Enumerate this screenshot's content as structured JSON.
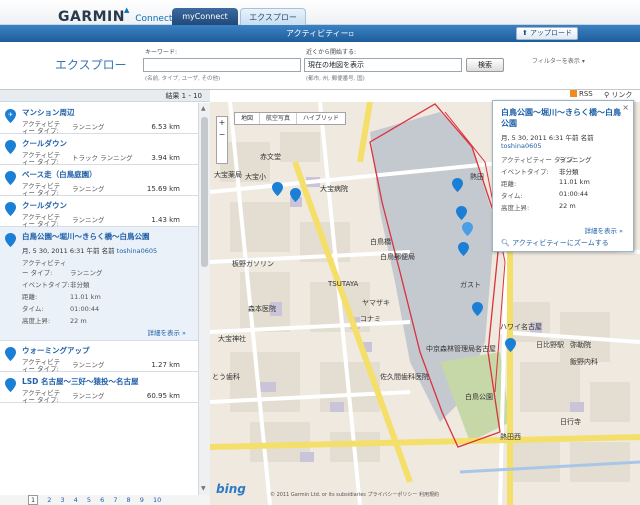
{
  "header": {
    "logo_text": "GARMIN",
    "logo_connect": "Connect",
    "tabs": [
      {
        "label": "myConnect"
      },
      {
        "label": "エクスプロー"
      }
    ],
    "activity_label": "アクティビティー▫",
    "upload_button": "⬆ アップロード"
  },
  "search": {
    "page_title": "エクスプロー",
    "keyword_label": "キーワード:",
    "keyword_value": "",
    "keyword_hint": "(名前, タイプ, ユーザ, その他)",
    "near_label": "近くから開始する:",
    "near_value": "現在の地図を表示",
    "near_hint": "(都市, 州, 郵便番号, 国)",
    "search_button": "検索",
    "filter_label": "フィルターを表示"
  },
  "results": {
    "count_label": "結果 1 - 10",
    "rss_label": "RSS",
    "link_label": "リンク",
    "items": [
      {
        "title": "マンション周辺",
        "type_key": "アクティビティー タイプ:",
        "type": "ランニング",
        "distance": "6.53 km"
      },
      {
        "title": "クールダウン",
        "type_key": "アクティビティー タイプ:",
        "type": "トラック ランニング",
        "distance": "3.94 km"
      },
      {
        "title": "ベース走（白鳥庭園）",
        "type_key": "アクティビティー タイプ:",
        "type": "ランニング",
        "distance": "15.69 km"
      },
      {
        "title": "クールダウン",
        "type_key": "アクティビティー タイプ:",
        "type": "ランニング",
        "distance": "1.43 km"
      }
    ],
    "selected": {
      "title": "白鳥公園～堀川～きらく橋～白鳥公園",
      "date": "月, 5 30, 2011 6:31 午前 名前",
      "user": "toshina0605",
      "type_key": "アクティビティー タイプ:",
      "type": "ランニング",
      "event_key": "イベントタイプ:",
      "event": "非分類",
      "dist_key": "距離:",
      "dist": "11.01 km",
      "time_key": "タイム:",
      "time": "01:00:44",
      "gain_key": "高度上昇:",
      "gain": "22 m",
      "show_details": "詳細を表示 »"
    },
    "items_after": [
      {
        "title": "ウォーミングアップ",
        "type_key": "アクティビティー タイプ:",
        "type": "ランニング",
        "distance": "1.27 km"
      },
      {
        "title": "LSD 名古屋～三好～猿投～名古屋",
        "type_key": "アクティビティー タイプ:",
        "type": "ランニング",
        "distance": "60.95 km"
      }
    ]
  },
  "pager": {
    "current": "1",
    "pages": [
      "2",
      "3",
      "4",
      "5",
      "6",
      "7",
      "8",
      "9",
      "10"
    ]
  },
  "map": {
    "type_buttons": [
      "地図",
      "航空写真",
      "ハイブリッド"
    ],
    "labels": [
      {
        "t": "赤文堂"
      },
      {
        "t": "大宝病院"
      },
      {
        "t": "大宝小"
      },
      {
        "t": "白鳥橋"
      },
      {
        "t": "板野ガソリン"
      },
      {
        "t": "TSUTAYA"
      },
      {
        "t": "森本医院"
      },
      {
        "t": "大宝神社"
      },
      {
        "t": "中京森林管理局名古屋"
      },
      {
        "t": "熱田"
      },
      {
        "t": "日比野駅"
      },
      {
        "t": "佐久間歯科医院"
      },
      {
        "t": "飯野内科"
      },
      {
        "t": "日行寺"
      },
      {
        "t": "白鳥公園"
      },
      {
        "t": "白鳥郵便局"
      },
      {
        "t": "ヤマザキ"
      },
      {
        "t": "コナミ"
      },
      {
        "t": "ガスト"
      },
      {
        "t": "熱田西"
      },
      {
        "t": "ハワイ名古屋"
      },
      {
        "t": "弥勒院"
      },
      {
        "t": "とう歯科"
      },
      {
        "t": "大宝薬局"
      }
    ],
    "bing": "bing",
    "copyright": "© 2011 Garmin Ltd. or its subsidiaries プライバシーポリシー 利用規約"
  },
  "bubble": {
    "title": "白鳥公園～堀川～きらく橋～白鳥公園",
    "date": "月, 5 30, 2011 6:31 午前 名前",
    "user": "toshina0605",
    "type_key": "アクティビティー タイプ:",
    "type": "ランニング",
    "event_key": "イベントタイプ:",
    "event": "非分類",
    "dist_key": "距離:",
    "dist": "11.01 km",
    "time_key": "タイム:",
    "time": "01:00:44",
    "gain_key": "高度上昇:",
    "gain": "22 m",
    "details": "詳細を表示 »",
    "zoom": "アクティビティーにズームする",
    "close": "×"
  },
  "colors": {
    "accent": "#1f5fa8",
    "blue_bar": "#2a6fb0",
    "route": "#d9333f",
    "park": "#b9bfc7"
  }
}
